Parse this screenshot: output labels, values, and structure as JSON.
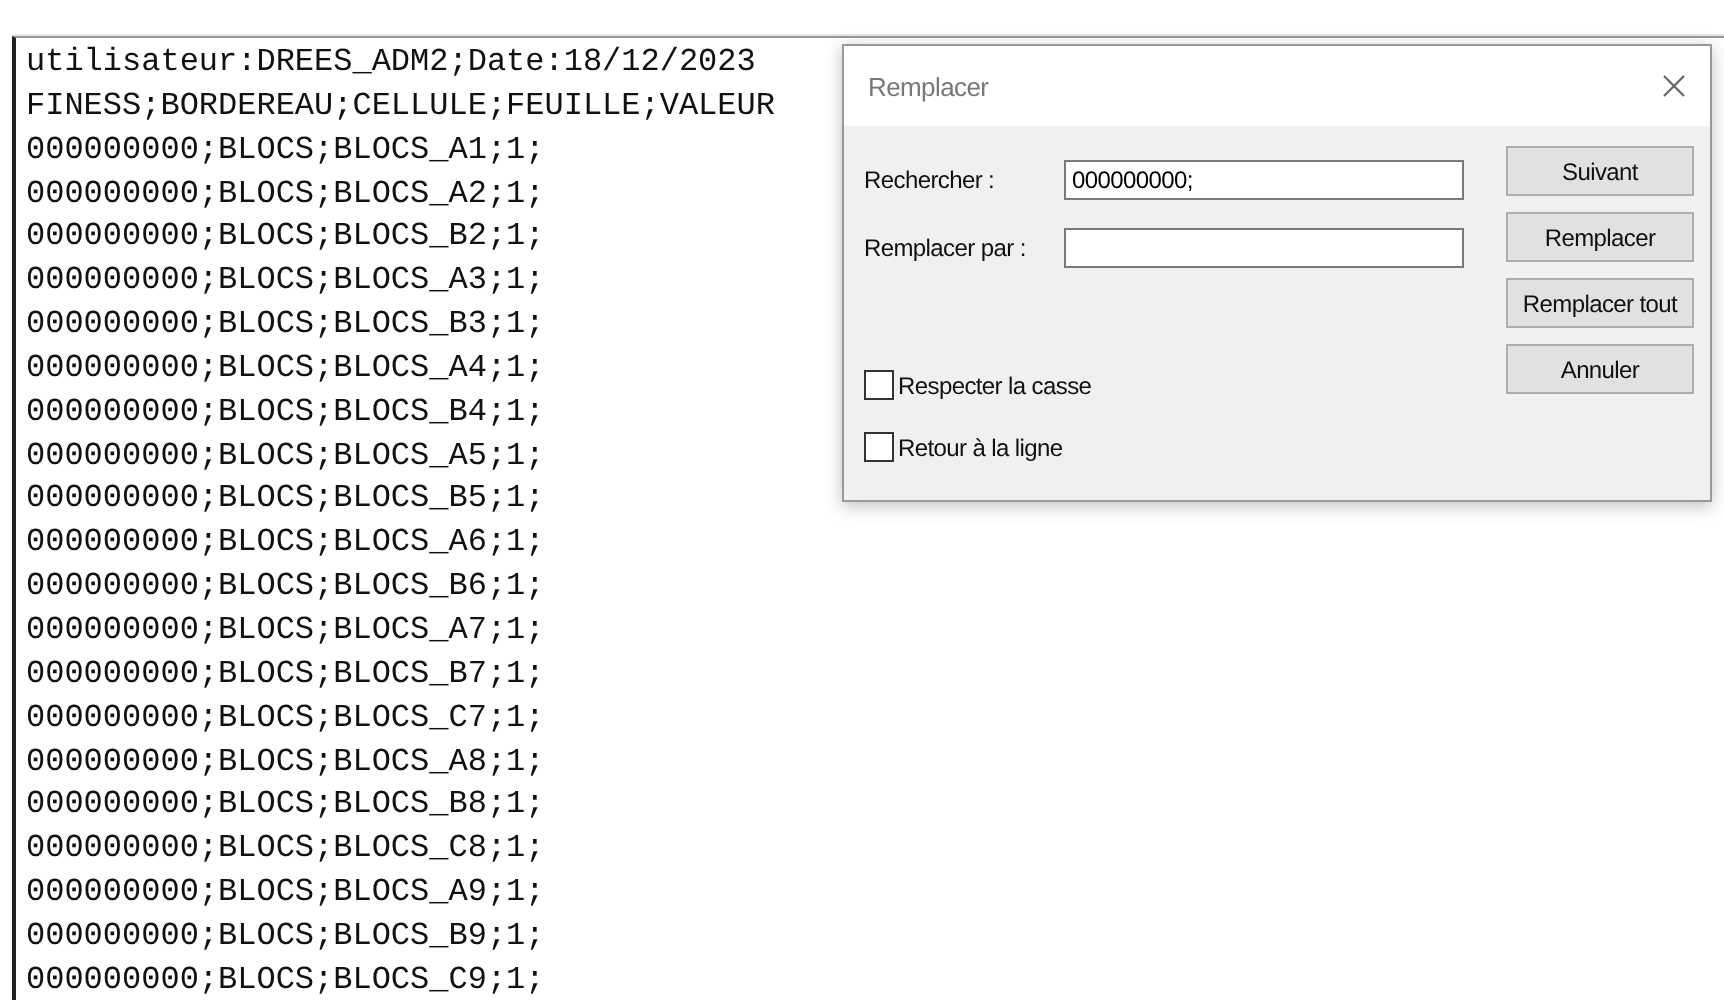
{
  "editor": {
    "lines": [
      "utilisateur:DREES_ADM2;Date:18/12/2023",
      "FINESS;BORDEREAU;CELLULE;FEUILLE;VALEUR",
      "000000000;BLOCS;BLOCS_A1;1;",
      "000000000;BLOCS;BLOCS_A2;1;",
      "000000000;BLOCS;BLOCS_B2;1;",
      "000000000;BLOCS;BLOCS_A3;1;",
      "000000000;BLOCS;BLOCS_B3;1;",
      "000000000;BLOCS;BLOCS_A4;1;",
      "000000000;BLOCS;BLOCS_B4;1;",
      "000000000;BLOCS;BLOCS_A5;1;",
      "000000000;BLOCS;BLOCS_B5;1;",
      "000000000;BLOCS;BLOCS_A6;1;",
      "000000000;BLOCS;BLOCS_B6;1;",
      "000000000;BLOCS;BLOCS_A7;1;",
      "000000000;BLOCS;BLOCS_B7;1;",
      "000000000;BLOCS;BLOCS_C7;1;",
      "000000000;BLOCS;BLOCS_A8;1;",
      "000000000;BLOCS;BLOCS_B8;1;",
      "000000000;BLOCS;BLOCS_C8;1;",
      "000000000;BLOCS;BLOCS_A9;1;",
      "000000000;BLOCS;BLOCS_B9;1;",
      "000000000;BLOCS;BLOCS_C9;1;"
    ]
  },
  "dialog": {
    "title": "Remplacer",
    "fields": [
      {
        "label": "Rechercher :",
        "value": "000000000;"
      },
      {
        "label": "Remplacer par :"
      }
    ],
    "checkboxes": [
      {
        "label": "Respecter la casse",
        "checked": false
      },
      {
        "label": "Retour à la ligne",
        "checked": false
      }
    ],
    "buttons": [
      "Suivant",
      "Remplacer",
      "Remplacer tout",
      "Annuler"
    ]
  }
}
